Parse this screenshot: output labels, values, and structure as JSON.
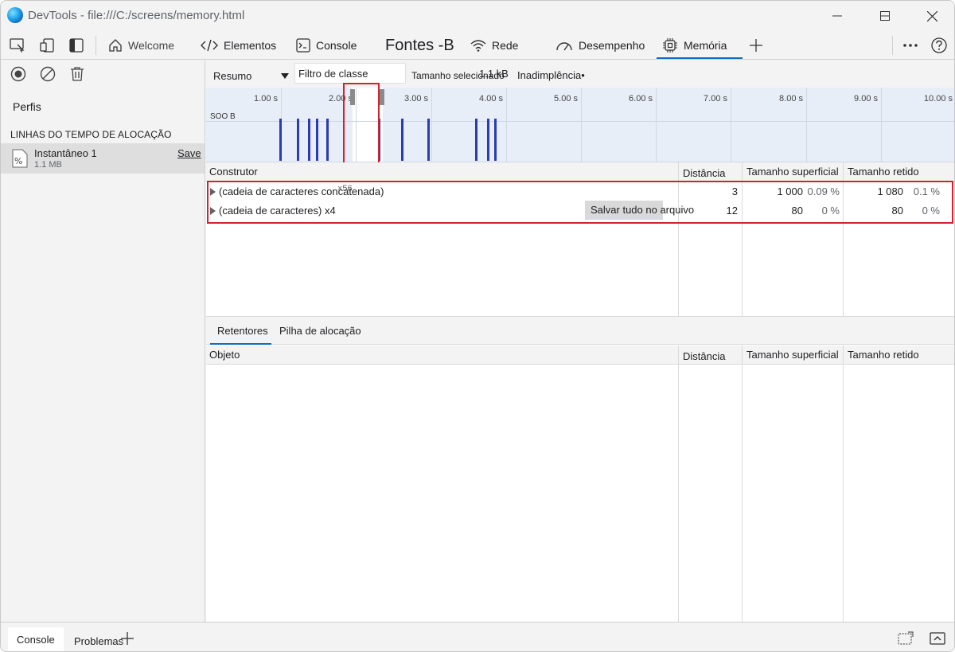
{
  "window": {
    "title": "DevTools - file:///C:/screens/memory.html"
  },
  "tabs": [
    {
      "label": "Welcome",
      "icon": "home-icon"
    },
    {
      "label": "Elementos",
      "icon": "code-icon"
    },
    {
      "label": "Console",
      "icon": "console-icon"
    },
    {
      "label": "Fontes -B",
      "icon": ""
    },
    {
      "label": "Rede",
      "icon": "wifi-icon"
    },
    {
      "label": "Desempenho",
      "icon": "gauge-icon"
    },
    {
      "label": "Memória",
      "icon": "chip-icon",
      "active": true
    }
  ],
  "sidebar": {
    "profiles_title": "Perfis",
    "section_title": "LINHAS DO TEMPO DE ALOCAÇÃO",
    "snapshot": {
      "name": "Instantâneo 1",
      "size": "1.1 MB",
      "save_label": "Save"
    }
  },
  "toolbar": {
    "view": "Resumo",
    "class_filter_placeholder": "Filtro de classe",
    "selected_size_label": "Tamanho selecionado",
    "selected_size_value": "1.1 kB",
    "default_label": "Inadimplência•"
  },
  "timeline": {
    "ticks": [
      "1.00 s",
      "2.00 s",
      "3.00 s",
      "4.00 s",
      "5.00 s",
      "6.00 s",
      "7.00 s",
      "8.00 s",
      "9.00 s",
      "10.00 s"
    ],
    "memory_label": "SOO B",
    "allocation_times_s": [
      0.98,
      1.21,
      1.36,
      1.46,
      1.6,
      2.29,
      2.6,
      2.95,
      3.59,
      3.75,
      3.84
    ],
    "selection_s": [
      1.95,
      2.35
    ]
  },
  "constructors": {
    "headers": {
      "constructor": "Construtor",
      "distance": "Distância",
      "shallow": "Tamanho superficial",
      "retained": "Tamanho retido"
    },
    "rows": [
      {
        "name": "(cadeia de caracteres concatenada)",
        "overlay": "×56",
        "distance": "3",
        "shallow": "1 000",
        "shallow_pct": "0.09 %",
        "retained": "1 080",
        "retained_pct": "0.1 %"
      },
      {
        "name": "(cadeia de caracteres) x4",
        "overlay": "",
        "distance": "12",
        "shallow": "80",
        "shallow_pct": "0 %",
        "retained": "80",
        "retained_pct": "0 %"
      }
    ],
    "tooltip": "Salvar tudo no arquivo"
  },
  "bottom": {
    "tabs": [
      "Retentores",
      "Pilha de alocação"
    ],
    "headers": {
      "object": "Objeto",
      "distance": "Distância",
      "shallow": "Tamanho superficial",
      "retained": "Tamanho retido"
    }
  },
  "drawer": {
    "tabs": [
      "Console",
      "Problemas"
    ]
  }
}
